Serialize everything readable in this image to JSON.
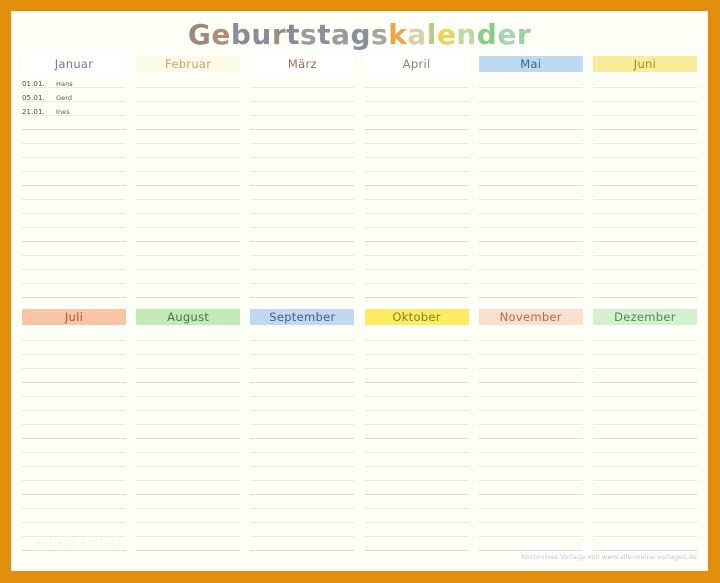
{
  "document": {
    "title_parts": [
      {
        "text": "G",
        "color": "#a08878"
      },
      {
        "text": "e",
        "color": "#b08c7a"
      },
      {
        "text": "b",
        "color": "#8c8c9a"
      },
      {
        "text": "u",
        "color": "#8a8a9c"
      },
      {
        "text": "r",
        "color": "#9a8f88"
      },
      {
        "text": "t",
        "color": "#8a8a96"
      },
      {
        "text": "s",
        "color": "#9c9c9c"
      },
      {
        "text": "t",
        "color": "#8e8e9a"
      },
      {
        "text": "a",
        "color": "#9a9a9a"
      },
      {
        "text": "g",
        "color": "#8e8e9a"
      },
      {
        "text": "s",
        "color": "#a6a6a0"
      },
      {
        "text": "k",
        "color": "#e8a84a"
      },
      {
        "text": "a",
        "color": "#d8d0a8"
      },
      {
        "text": "l",
        "color": "#b8cc8a"
      },
      {
        "text": "e",
        "color": "#ead45c"
      },
      {
        "text": "n",
        "color": "#b9d9a0"
      },
      {
        "text": "d",
        "color": "#8fc98a"
      },
      {
        "text": "e",
        "color": "#a7d3b6"
      },
      {
        "text": "r",
        "color": "#9fd0a4"
      }
    ],
    "title_text": "Geburtstagskalender",
    "watermark": "Vorlage hosting",
    "footer_credit": "Kostenlose Vorlage von www.alle-meine-vorlagen.de",
    "frame_color": "#E08E0B",
    "paper_color": "#FEFEF8",
    "rule_color": "#e7e9e4"
  },
  "rows_per_month": 16,
  "months": [
    {
      "name": "Januar",
      "header_bg": "#ffffff",
      "header_color": "#6b7f9e",
      "entries": [
        {
          "date": "01.01.",
          "name": "Hans"
        },
        {
          "date": "05.01.",
          "name": "Gerd"
        },
        {
          "date": "21.01.",
          "name": "Ines"
        }
      ]
    },
    {
      "name": "Februar",
      "header_bg": "#fdfbe8",
      "header_color": "#b9a867",
      "entries": []
    },
    {
      "name": "März",
      "header_bg": "#ffffff",
      "header_color": "#b06a52",
      "entries": []
    },
    {
      "name": "April",
      "header_bg": "#ffffff",
      "header_color": "#8a8275",
      "entries": []
    },
    {
      "name": "Mai",
      "header_bg": "#bed8f2",
      "header_color": "#43618f",
      "entries": []
    },
    {
      "name": "Juni",
      "header_bg": "#fbec9c",
      "header_color": "#9a8c2e",
      "entries": []
    },
    {
      "name": "Juli",
      "header_bg": "#f7c4a4",
      "header_color": "#b4553a",
      "entries": []
    },
    {
      "name": "August",
      "header_bg": "#c2e9b8",
      "header_color": "#3f7a43",
      "entries": []
    },
    {
      "name": "September",
      "header_bg": "#c3d6f2",
      "header_color": "#3f5d90",
      "entries": []
    },
    {
      "name": "Oktober",
      "header_bg": "#fbec62",
      "header_color": "#8a7a22",
      "entries": []
    },
    {
      "name": "November",
      "header_bg": "#fadfcf",
      "header_color": "#b06a52",
      "entries": []
    },
    {
      "name": "Dezember",
      "header_bg": "#d4f0cf",
      "header_color": "#4d8a50",
      "entries": []
    }
  ]
}
